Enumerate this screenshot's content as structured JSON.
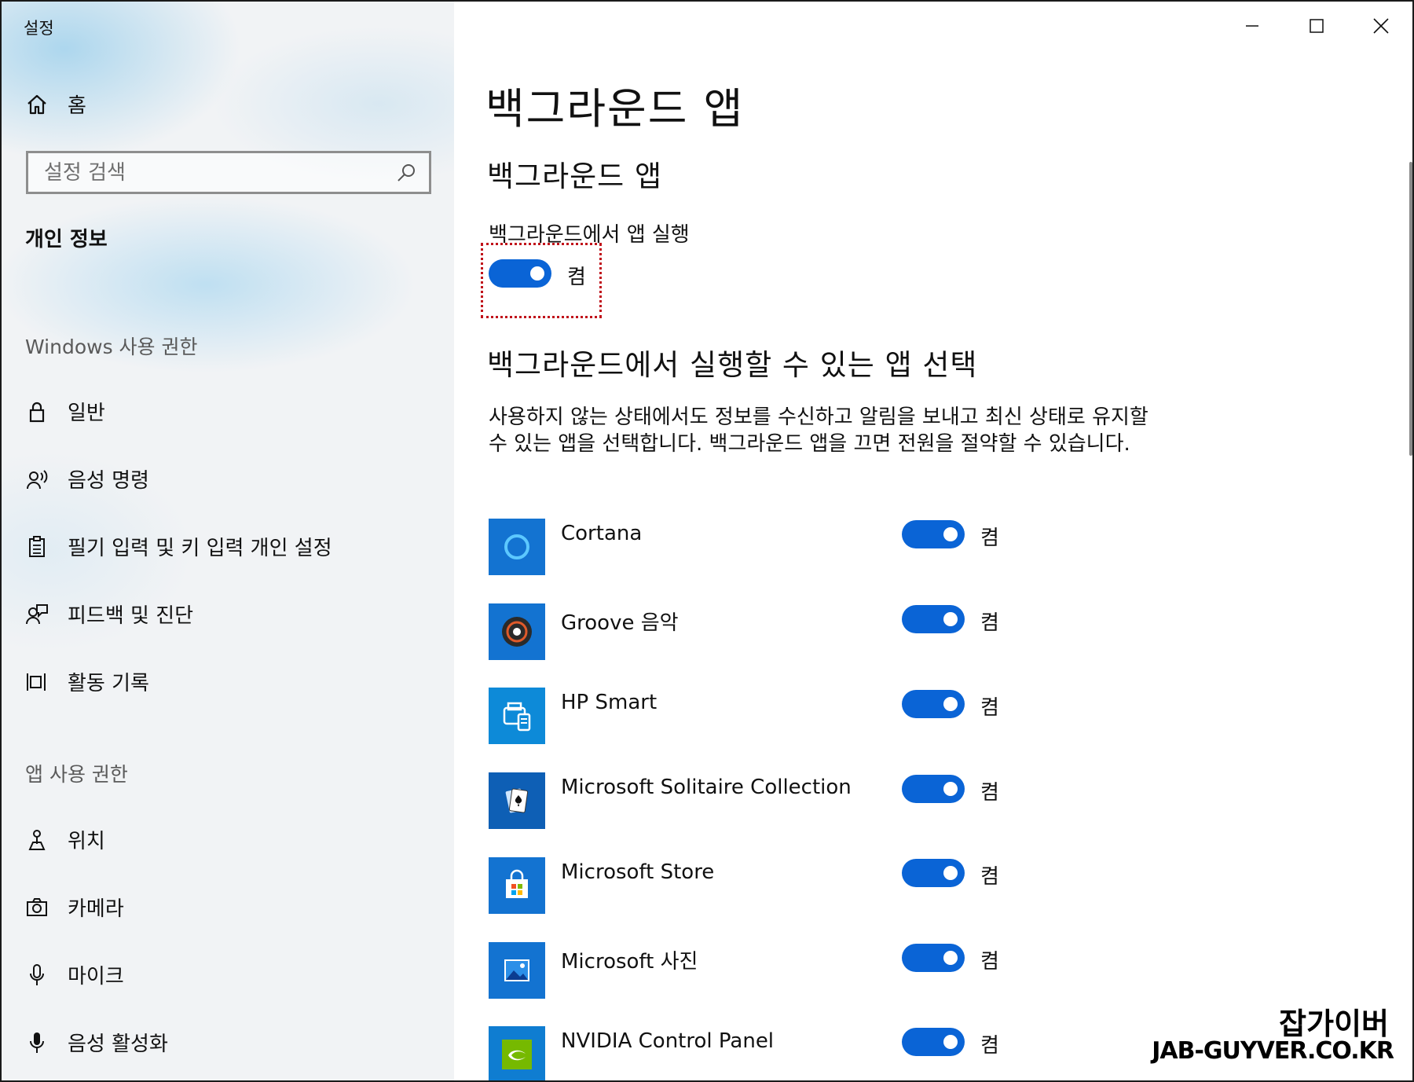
{
  "window": {
    "title": "설정"
  },
  "sidebar": {
    "home_label": "홈",
    "search_placeholder": "설정 검색",
    "section_title": "개인 정보",
    "windows_permissions_label": "Windows 사용 권한",
    "windows_items": [
      {
        "label": "일반",
        "icon": "lock-icon"
      },
      {
        "label": "음성 명령",
        "icon": "voice-icon"
      },
      {
        "label": "필기 입력 및 키 입력 개인 설정",
        "icon": "clipboard-icon"
      },
      {
        "label": "피드백 및 진단",
        "icon": "feedback-icon"
      },
      {
        "label": "활동 기록",
        "icon": "timeline-icon"
      }
    ],
    "app_permissions_label": "앱 사용 권한",
    "app_items": [
      {
        "label": "위치",
        "icon": "location-icon"
      },
      {
        "label": "카메라",
        "icon": "camera-icon"
      },
      {
        "label": "마이크",
        "icon": "microphone-icon"
      },
      {
        "label": "음성 활성화",
        "icon": "voice-activation-icon"
      }
    ]
  },
  "main": {
    "page_title": "백그라운드 앱",
    "section1_title": "백그라운드 앱",
    "run_in_background_label": "백그라운드에서 앱 실행",
    "run_in_background_state": "켬",
    "run_in_background_on": true,
    "section2_title": "백그라운드에서 실행할 수 있는 앱 선택",
    "description": "사용하지 않는 상태에서도 정보를 수신하고 알림을 보내고 최신 상태로 유지할 수 있는 앱을 선택합니다. 백그라운드 앱을 끄면 전원을 절약할 수 있습니다.",
    "apps": [
      {
        "name": "Cortana",
        "state": "켬",
        "on": true,
        "icon": "cortana-icon"
      },
      {
        "name": "Groove 음악",
        "state": "켬",
        "on": true,
        "icon": "groove-music-icon"
      },
      {
        "name": "HP Smart",
        "state": "켬",
        "on": true,
        "icon": "hp-smart-icon"
      },
      {
        "name": "Microsoft Solitaire Collection",
        "state": "켬",
        "on": true,
        "icon": "solitaire-icon"
      },
      {
        "name": "Microsoft Store",
        "state": "켬",
        "on": true,
        "icon": "store-icon"
      },
      {
        "name": "Microsoft 사진",
        "state": "켬",
        "on": true,
        "icon": "photos-icon"
      },
      {
        "name": "NVIDIA Control Panel",
        "state": "켬",
        "on": true,
        "icon": "nvidia-icon"
      }
    ]
  },
  "watermark": {
    "line1": "잡가이버",
    "line2": "JAB-GUYVER.CO.KR"
  },
  "colors": {
    "accent": "#0a64d6",
    "tile": "#1373d1",
    "highlight_border": "#c0111a"
  }
}
